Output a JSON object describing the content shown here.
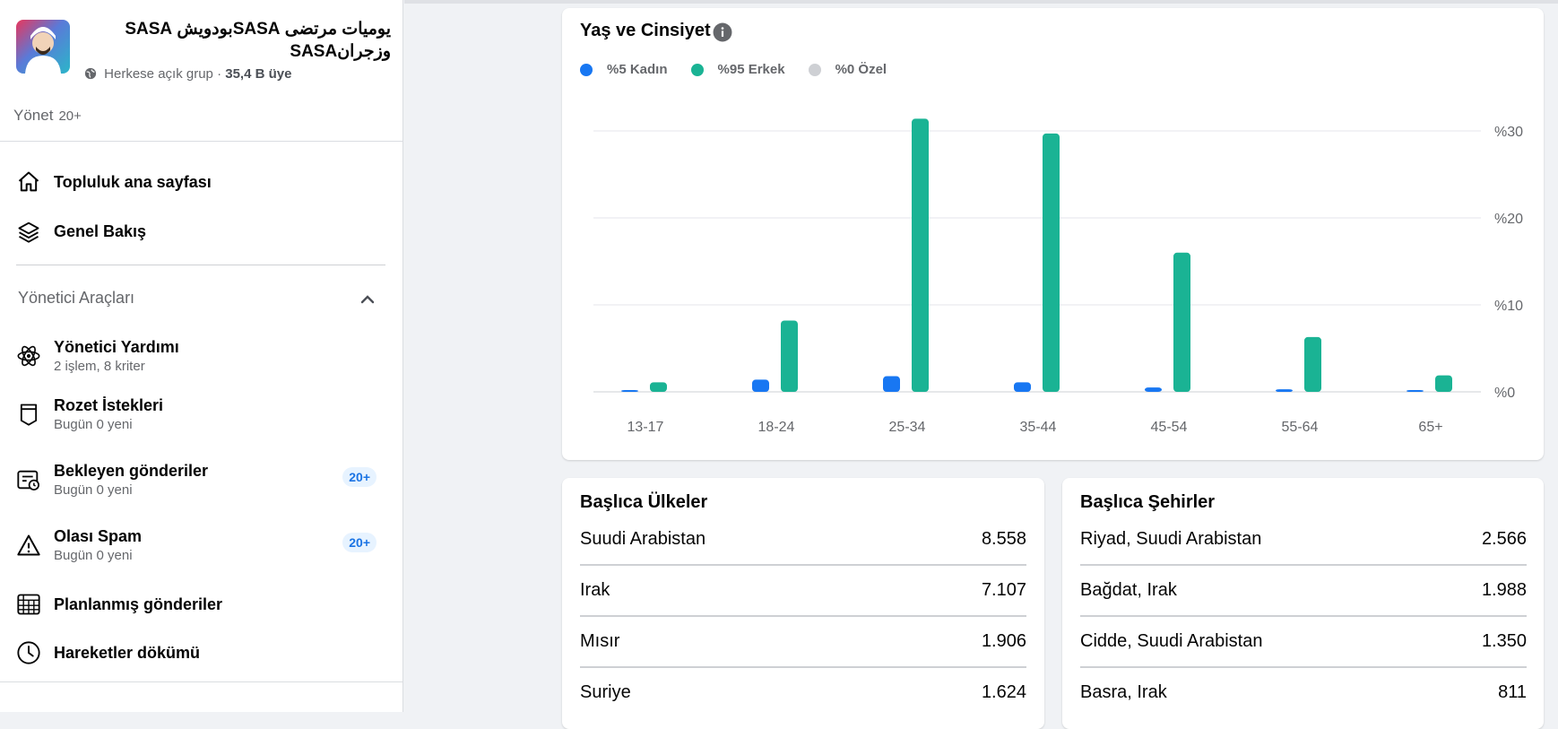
{
  "sidebar": {
    "group_name": "يوميات مرتضى SASAبودويش SASA وزجرانSASA",
    "privacy": "Herkese açık grup",
    "separator": " · ",
    "members": "35,4 B üye",
    "manage": {
      "label": "Yönet",
      "count": "20+"
    },
    "nav": [
      {
        "label": "Topluluk ana sayfası",
        "icon": "home-icon"
      },
      {
        "label": "Genel Bakış",
        "icon": "layers-icon"
      }
    ],
    "admin_tools": {
      "header": "Yönetici Araçları",
      "items": [
        {
          "label": "Yönetici Yardımı",
          "sub": "2 işlem, 8 kriter",
          "icon": "atom-icon"
        },
        {
          "label": "Rozet İstekleri",
          "sub": "Bugün 0 yeni",
          "icon": "badge-icon"
        },
        {
          "label": "Bekleyen gönderiler",
          "sub": "Bugün 0 yeni",
          "badge": "20+",
          "icon": "pending-posts-icon"
        },
        {
          "label": "Olası Spam",
          "sub": "Bugün 0 yeni",
          "badge": "20+",
          "icon": "warning-icon"
        },
        {
          "label": "Planlanmış gönderiler",
          "icon": "calendar-icon"
        },
        {
          "label": "Hareketler dökümü",
          "icon": "clock-icon"
        }
      ]
    }
  },
  "chart_card": {
    "title": "Yaş ve Cinsiyet",
    "legend": [
      {
        "label": "%5 Kadın",
        "color": "#1877f2"
      },
      {
        "label": "%95 Erkek",
        "color": "#1ab394"
      },
      {
        "label": "%0 Özel",
        "color": "#ced0d4"
      }
    ]
  },
  "chart_data": {
    "type": "bar",
    "categories": [
      "13-17",
      "18-24",
      "25-34",
      "35-44",
      "45-54",
      "55-64",
      "65+"
    ],
    "series": [
      {
        "name": "Kadın",
        "color": "#1877f2",
        "values": [
          0.2,
          1.4,
          1.8,
          1.1,
          0.5,
          0.3,
          0.2
        ]
      },
      {
        "name": "Erkek",
        "color": "#1ab394",
        "values": [
          1.1,
          8.2,
          31.4,
          29.7,
          16.0,
          6.3,
          1.9
        ]
      }
    ],
    "ylim": [
      0,
      30
    ],
    "yticks": [
      "%0",
      "%10",
      "%20",
      "%30"
    ],
    "ytick_values": [
      0,
      10,
      20,
      30
    ],
    "grid": true
  },
  "countries": {
    "title": "Başlıca Ülkeler",
    "rows": [
      {
        "name": "Suudi Arabistan",
        "value": "8.558"
      },
      {
        "name": "Irak",
        "value": "7.107"
      },
      {
        "name": "Mısır",
        "value": "1.906"
      },
      {
        "name": "Suriye",
        "value": "1.624"
      }
    ]
  },
  "cities": {
    "title": "Başlıca Şehirler",
    "rows": [
      {
        "name": "Riyad, Suudi Arabistan",
        "value": "2.566"
      },
      {
        "name": "Bağdat, Irak",
        "value": "1.988"
      },
      {
        "name": "Cidde, Suudi Arabistan",
        "value": "1.350"
      },
      {
        "name": "Basra, Irak",
        "value": "811"
      }
    ]
  }
}
